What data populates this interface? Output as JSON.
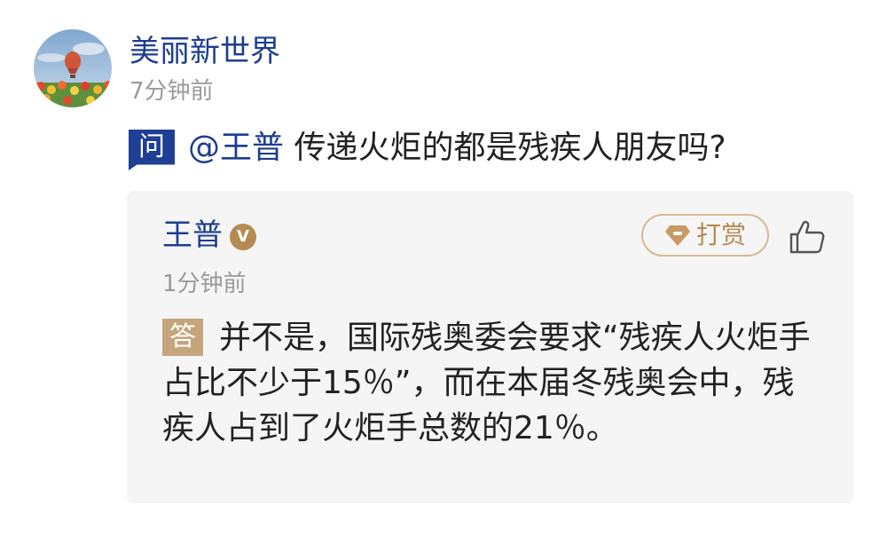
{
  "post": {
    "username": "美丽新世界",
    "time": "7分钟前",
    "avatar_icon": "balloon-tulip-avatar"
  },
  "question": {
    "badge": "问",
    "mention": "@王普",
    "text": " 传递火炬的都是残疾人朋友吗?"
  },
  "answer": {
    "name": "王普",
    "verified_badge": "V",
    "tip_label": "打赏",
    "tip_icon": "gem-icon",
    "like_icon": "thumbs-up-icon",
    "time": "1分钟前",
    "badge": "答",
    "text": "并不是，国际残奥委会要求“残疾人火炬手占比不少于15％”，而在本届冬残奥会中，残疾人占到了火炬手总数的21％。"
  },
  "colors": {
    "name_blue": "#1d3d8f",
    "question_badge": "#1f3f94",
    "answer_badge": "#c5a57c",
    "gold": "#b48b52",
    "meta_gray": "#9a9a9a",
    "card_bg": "#f5f5f5"
  }
}
